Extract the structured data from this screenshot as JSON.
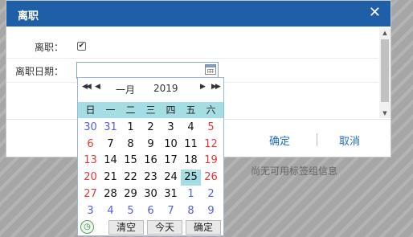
{
  "background": {
    "hint": "尚无可用标签组信息"
  },
  "dialog": {
    "title": "离职",
    "close_glyph": "✕",
    "fields": {
      "resigned_label": "离职：",
      "resigned_checked": true,
      "resign_date_label": "离职日期：",
      "resign_date_value": ""
    },
    "buttons": {
      "ok": "确定",
      "cancel": "取消"
    }
  },
  "calendar": {
    "nav": {
      "prev_year": "◀◀",
      "prev_month": "◀",
      "next_month": "▶",
      "next_year": "▶▶"
    },
    "month": "一月",
    "year": "2019",
    "weekdays": [
      "日",
      "一",
      "二",
      "三",
      "四",
      "五",
      "六"
    ],
    "weeks": [
      [
        "30",
        "31",
        "1",
        "2",
        "3",
        "4",
        "5"
      ],
      [
        "6",
        "7",
        "8",
        "9",
        "10",
        "11",
        "12"
      ],
      [
        "13",
        "14",
        "15",
        "16",
        "17",
        "18",
        "19"
      ],
      [
        "20",
        "21",
        "22",
        "23",
        "24",
        "25",
        "26"
      ],
      [
        "27",
        "28",
        "29",
        "30",
        "31",
        "1",
        "2"
      ],
      [
        "3",
        "4",
        "5",
        "6",
        "7",
        "8",
        "9"
      ]
    ],
    "selected_day": "25",
    "footer": {
      "today_icon_glyph": "◷",
      "clear": "清空",
      "today": "今天",
      "confirm": "确定"
    }
  },
  "colors": {
    "titlebar": "#1f5fa7",
    "weekday_band": "#a4dde3",
    "weekend_red": "#e03a3a",
    "other_month_blue": "#5560d8",
    "link_blue": "#1f6fc2"
  }
}
